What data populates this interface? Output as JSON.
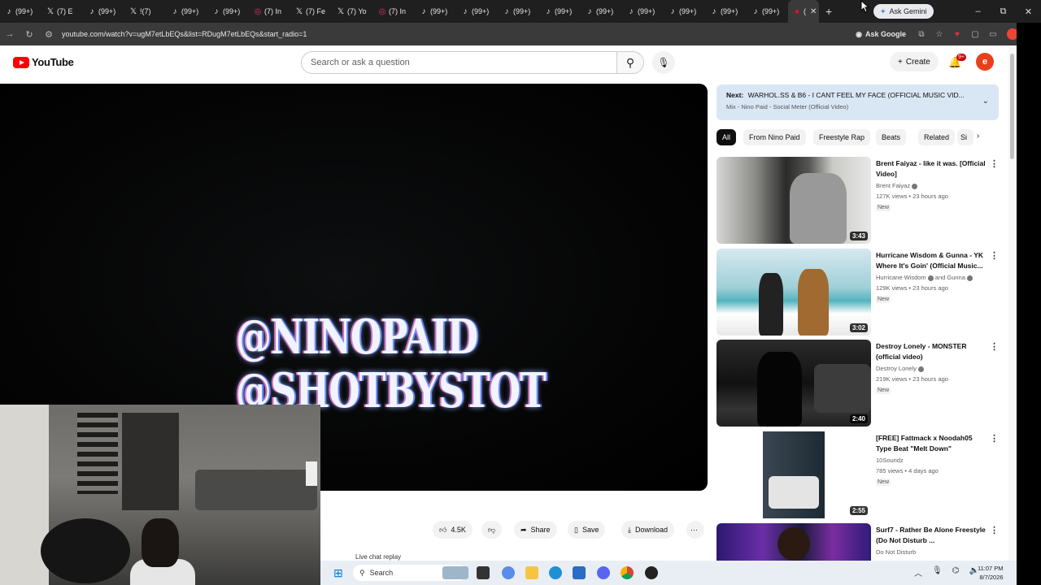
{
  "browser": {
    "tabs": [
      {
        "icon": "tiktok-icon",
        "glyph": "♪",
        "label": "(99+)"
      },
      {
        "icon": "x-icon",
        "glyph": "𝕏",
        "label": "(7) E"
      },
      {
        "icon": "tiktok-icon",
        "glyph": "♪",
        "label": "(99+)"
      },
      {
        "icon": "x-icon",
        "glyph": "𝕏",
        "label": "!(7)"
      },
      {
        "icon": "tiktok-icon",
        "glyph": "♪",
        "label": "(99+)"
      },
      {
        "icon": "tiktok-icon",
        "glyph": "♪",
        "label": "(99+)"
      },
      {
        "icon": "instagram-icon",
        "glyph": "◎",
        "label": "(7) In"
      },
      {
        "icon": "x-icon",
        "glyph": "𝕏",
        "label": "(7) Fe"
      },
      {
        "icon": "x-icon",
        "glyph": "𝕏",
        "label": "(7) Yo"
      },
      {
        "icon": "instagram-icon",
        "glyph": "◎",
        "label": "(7) In"
      },
      {
        "icon": "tiktok-icon",
        "glyph": "♪",
        "label": "(99+)"
      },
      {
        "icon": "tiktok-icon",
        "glyph": "♪",
        "label": "(99+)"
      },
      {
        "icon": "tiktok-icon",
        "glyph": "♪",
        "label": "(99+)"
      },
      {
        "icon": "tiktok-icon",
        "glyph": "♪",
        "label": "(99+)"
      },
      {
        "icon": "tiktok-icon",
        "glyph": "♪",
        "label": "(99+)"
      },
      {
        "icon": "tiktok-icon",
        "glyph": "♪",
        "label": "(99+)"
      },
      {
        "icon": "tiktok-icon",
        "glyph": "♪",
        "label": "(99+)"
      },
      {
        "icon": "tiktok-icon",
        "glyph": "♪",
        "label": "(99+)"
      },
      {
        "icon": "tiktok-icon",
        "glyph": "♪",
        "label": "(99+)"
      }
    ],
    "active_tab": {
      "icon": "youtube-icon",
      "glyph": "●",
      "label": "(",
      "close": "✕"
    },
    "new_tab": "+",
    "ask_gemini": "Ask Gemini",
    "window_controls": {
      "minimize": "–",
      "restore": "⧉",
      "close": "✕"
    },
    "url": "youtube.com/watch?v=ugM7etLbEQs&list=RDugM7etLbEQs&start_radio=1",
    "ask_google": "Ask Google"
  },
  "youtube": {
    "logo_text": "YouTube",
    "search_placeholder": "Search or ask a question",
    "create_label": "Create",
    "notification_count": "9+",
    "avatar_letter": "e",
    "video_overlay_lines": [
      "@NINOPAID",
      "@SHOTBYSTOT"
    ],
    "actions": {
      "like_count": "4.5K",
      "share": "Share",
      "save": "Save",
      "download": "Download"
    },
    "live_chat_replay": "Live chat replay",
    "up_next": {
      "prefix": "Next:",
      "title": "WARHOL.SS & B6 - I CANT FEEL MY FACE (OFFICIAL MUSIC VID...",
      "mix_line": "Mix - Nino Paid - Social Meter (Official Video)"
    },
    "chips": [
      "All",
      "From Nino Paid",
      "Freestyle Rap",
      "Beats",
      "Related",
      "Si"
    ],
    "recommendations": [
      {
        "title": "Brent Faiyaz - like it was. [Official Video]",
        "channel": "Brent Faiyaz",
        "verified": true,
        "meta": "127K views • 23 hours ago",
        "badge": "New",
        "duration": "3:43"
      },
      {
        "title": "Hurricane Wisdom & Gunna - YK Where It's Goin' (Official Music...",
        "channel": "Hurricane Wisdom",
        "channel2": "and Gunna",
        "verified": true,
        "meta": "129K views • 23 hours ago",
        "badge": "New",
        "duration": "3:02"
      },
      {
        "title": "Destroy Lonely - MONSTER (official video)",
        "channel": "Destroy Lonely",
        "verified": true,
        "meta": "219K views • 23 hours ago",
        "badge": "New",
        "duration": "2:40"
      },
      {
        "title": "[FREE] Fattmack x Noodah05 Type Beat \"Melt Down\"",
        "channel": "10Soundz",
        "verified": false,
        "meta": "785 views • 4 days ago",
        "badge": "New",
        "duration": "2:55"
      },
      {
        "title": "Surf7 - Rather Be Alone Freestyle (Do Not Disturb ...",
        "channel": "Do Not Disturb",
        "verified": false,
        "meta": "",
        "badge": "",
        "duration": ""
      }
    ]
  },
  "taskbar": {
    "search_label": "Search",
    "time": "11:07 PM",
    "date": "8/7/2026"
  },
  "colors": {
    "youtube_red": "#ff0000",
    "up_next_bg": "#d9e7f5",
    "chrome_dark": "#1f1f1f"
  }
}
